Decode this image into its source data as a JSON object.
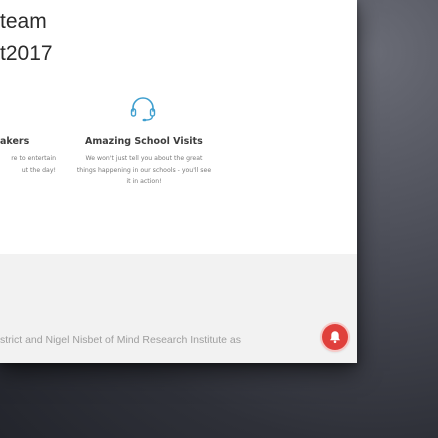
{
  "hero": {
    "heading_line1": "team",
    "heading_line2": "t2017"
  },
  "features": [
    {
      "title": "akers",
      "desc_lines": [
        "re to entertain",
        "ut the day!"
      ]
    },
    {
      "icon": "headset-icon",
      "title": "Amazing School Visits",
      "desc_lines": [
        "We won't just tell you about the great",
        "things happening in our schools - you'll see",
        "it in action!"
      ]
    }
  ],
  "footer": {
    "text": "strict and Nigel Nisbet of Mind Research Institute as"
  },
  "notification": {
    "icon": "bell-icon",
    "color": "#e0403c"
  },
  "colors": {
    "accent_icon": "#3f9fcf",
    "footer_bg": "#f2f2f2"
  }
}
